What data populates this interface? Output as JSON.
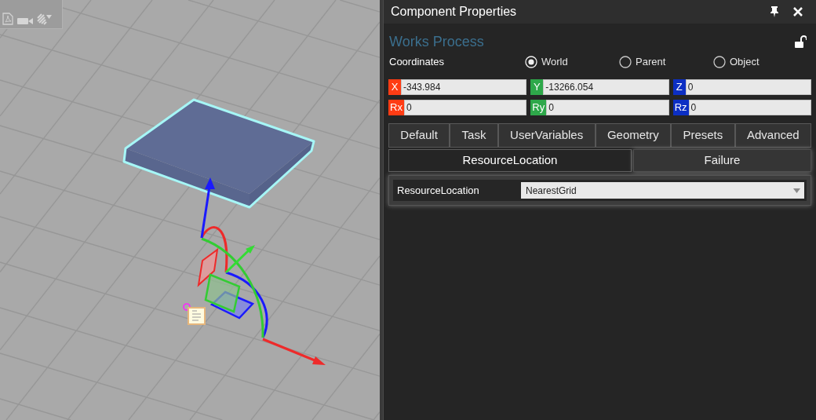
{
  "panel": {
    "title": "Component Properties"
  },
  "component": {
    "name": "Works Process",
    "locked": false
  },
  "coordinates": {
    "label": "Coordinates",
    "options": [
      {
        "label": "World",
        "selected": true
      },
      {
        "label": "Parent",
        "selected": false
      },
      {
        "label": "Object",
        "selected": false
      }
    ]
  },
  "fields": [
    {
      "axis": "X",
      "value": "-343.984",
      "color": "#ff3c14"
    },
    {
      "axis": "Y",
      "value": "-13266.054",
      "color": "#2ea84a"
    },
    {
      "axis": "Z",
      "value": "0",
      "color": "#0c2fc4"
    },
    {
      "axis": "Rx",
      "value": "0",
      "color": "#ff3c14"
    },
    {
      "axis": "Ry",
      "value": "0",
      "color": "#2ea84a"
    },
    {
      "axis": "Rz",
      "value": "0",
      "color": "#0c2fc4"
    }
  ],
  "tabs": [
    {
      "label": "Default"
    },
    {
      "label": "Task"
    },
    {
      "label": "UserVariables"
    },
    {
      "label": "Geometry"
    },
    {
      "label": "Presets"
    },
    {
      "label": "Advanced"
    }
  ],
  "subtabs": [
    {
      "label": "ResourceLocation",
      "selected": true
    },
    {
      "label": "Failure",
      "selected": false
    }
  ],
  "properties": [
    {
      "label": "ResourceLocation",
      "value": "NearestGrid"
    }
  ]
}
